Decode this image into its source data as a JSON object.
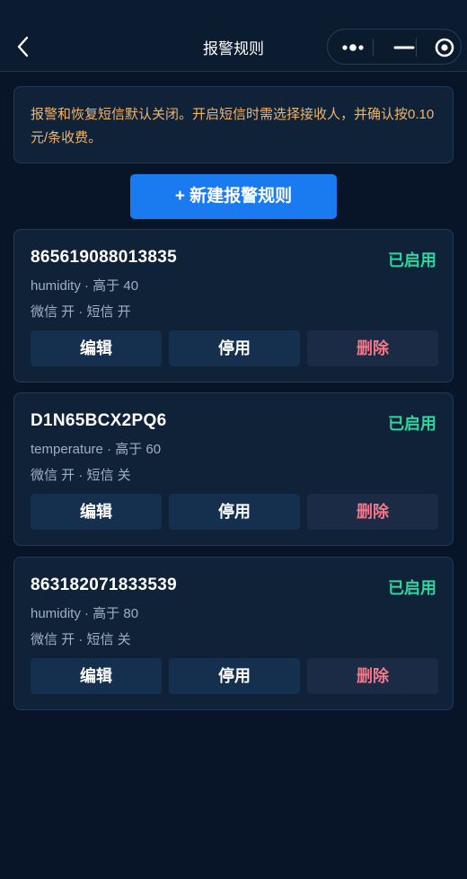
{
  "navbar": {
    "title": "报警规则",
    "back_icon": "chevron-left-icon",
    "capsule_icons": [
      "more-dots-icon",
      "minimize-icon",
      "target-icon"
    ]
  },
  "notice": {
    "text": "报警和恢复短信默认关闭。开启短信时需选择接收人，并确认按0.10元/条收费。"
  },
  "actions": {
    "new_rule_label": "+ 新建报警规则"
  },
  "rules": [
    {
      "device_id": "865619088013835",
      "status": "已启用",
      "metric": "humidity · 高于 40",
      "notify": "微信 开 · 短信 开",
      "edit_label": "编辑",
      "disable_label": "停用",
      "delete_label": "删除"
    },
    {
      "device_id": "D1N65BCX2PQ6",
      "status": "已启用",
      "metric": "temperature · 高于 60",
      "notify": "微信 开 · 短信 关",
      "edit_label": "编辑",
      "disable_label": "停用",
      "delete_label": "删除"
    },
    {
      "device_id": "863182071833539",
      "status": "已启用",
      "metric": "humidity · 高于 80",
      "notify": "微信 开 · 短信 关",
      "edit_label": "编辑",
      "disable_label": "停用",
      "delete_label": "删除"
    }
  ],
  "colors": {
    "background": "#081528",
    "card": "#0f2238",
    "accent": "#1a7af0",
    "status_enabled": "#2ed6a0",
    "notice_text": "#f0b46a",
    "danger": "#f0788a"
  }
}
